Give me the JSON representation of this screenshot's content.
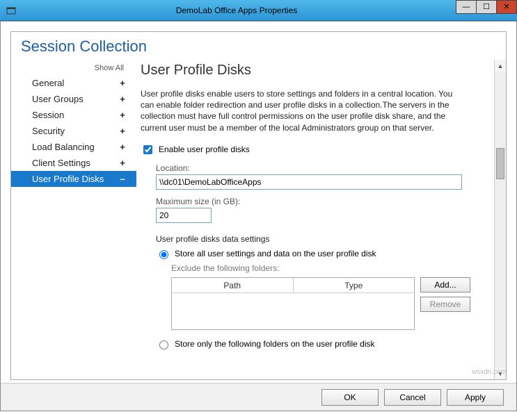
{
  "window": {
    "title": "DemoLab Office Apps Properties"
  },
  "header": {
    "title": "Session Collection"
  },
  "sidebar": {
    "show_all": "Show All",
    "items": [
      {
        "label": "General",
        "expander": "+",
        "selected": false
      },
      {
        "label": "User Groups",
        "expander": "+",
        "selected": false
      },
      {
        "label": "Session",
        "expander": "+",
        "selected": false
      },
      {
        "label": "Security",
        "expander": "+",
        "selected": false
      },
      {
        "label": "Load Balancing",
        "expander": "+",
        "selected": false
      },
      {
        "label": "Client Settings",
        "expander": "+",
        "selected": false
      },
      {
        "label": "User Profile Disks",
        "expander": "–",
        "selected": true
      }
    ]
  },
  "main": {
    "heading": "User Profile Disks",
    "description": "User profile disks enable users to store settings and folders in a central location. You can enable folder redirection and user profile disks in a collection.The servers in the collection must have full control permissions on the user profile disk share, and the current user must be a member of the local Administrators group on that server.",
    "enable_label": "Enable user profile disks",
    "enable_checked": true,
    "location_label": "Location:",
    "location_value": "\\\\dc01\\DemoLabOfficeApps",
    "maxsize_label": "Maximum size (in GB):",
    "maxsize_value": "20",
    "data_settings_label": "User profile disks data settings",
    "radio_store_all": "Store all user settings and data on the user profile disk",
    "exclude_label": "Exclude the following folders:",
    "table_headers": {
      "path": "Path",
      "type": "Type"
    },
    "add_button": "Add...",
    "remove_button": "Remove",
    "radio_store_only": "Store only the following folders on the user profile disk",
    "selected_radio": "all"
  },
  "footer": {
    "ok": "OK",
    "cancel": "Cancel",
    "apply": "Apply"
  },
  "watermark": "wsxdn.com"
}
